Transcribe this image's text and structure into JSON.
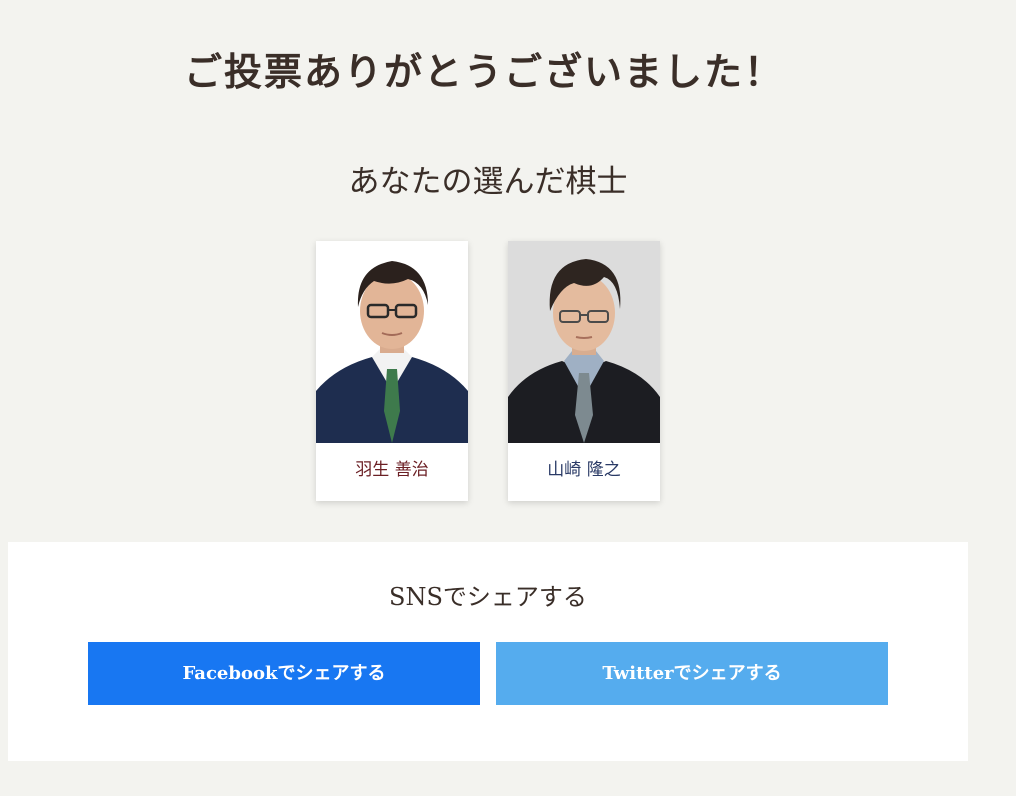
{
  "page": {
    "title": "ご投票ありがとうございました！",
    "subtitle": "あなたの選んだ棋士"
  },
  "selected_players": [
    {
      "name": "羽生 善治",
      "photo": "portrait-photo",
      "name_color": "#6b1f24"
    },
    {
      "name": "山崎 隆之",
      "photo": "portrait-photo",
      "name_color": "#2a3a66"
    }
  ],
  "share": {
    "title": "SNSでシェアする",
    "facebook_label": "Facebookでシェアする",
    "twitter_label": "Twitterでシェアする"
  },
  "colors": {
    "background": "#f3f3ef",
    "facebook": "#1877f2",
    "twitter": "#55acee"
  }
}
